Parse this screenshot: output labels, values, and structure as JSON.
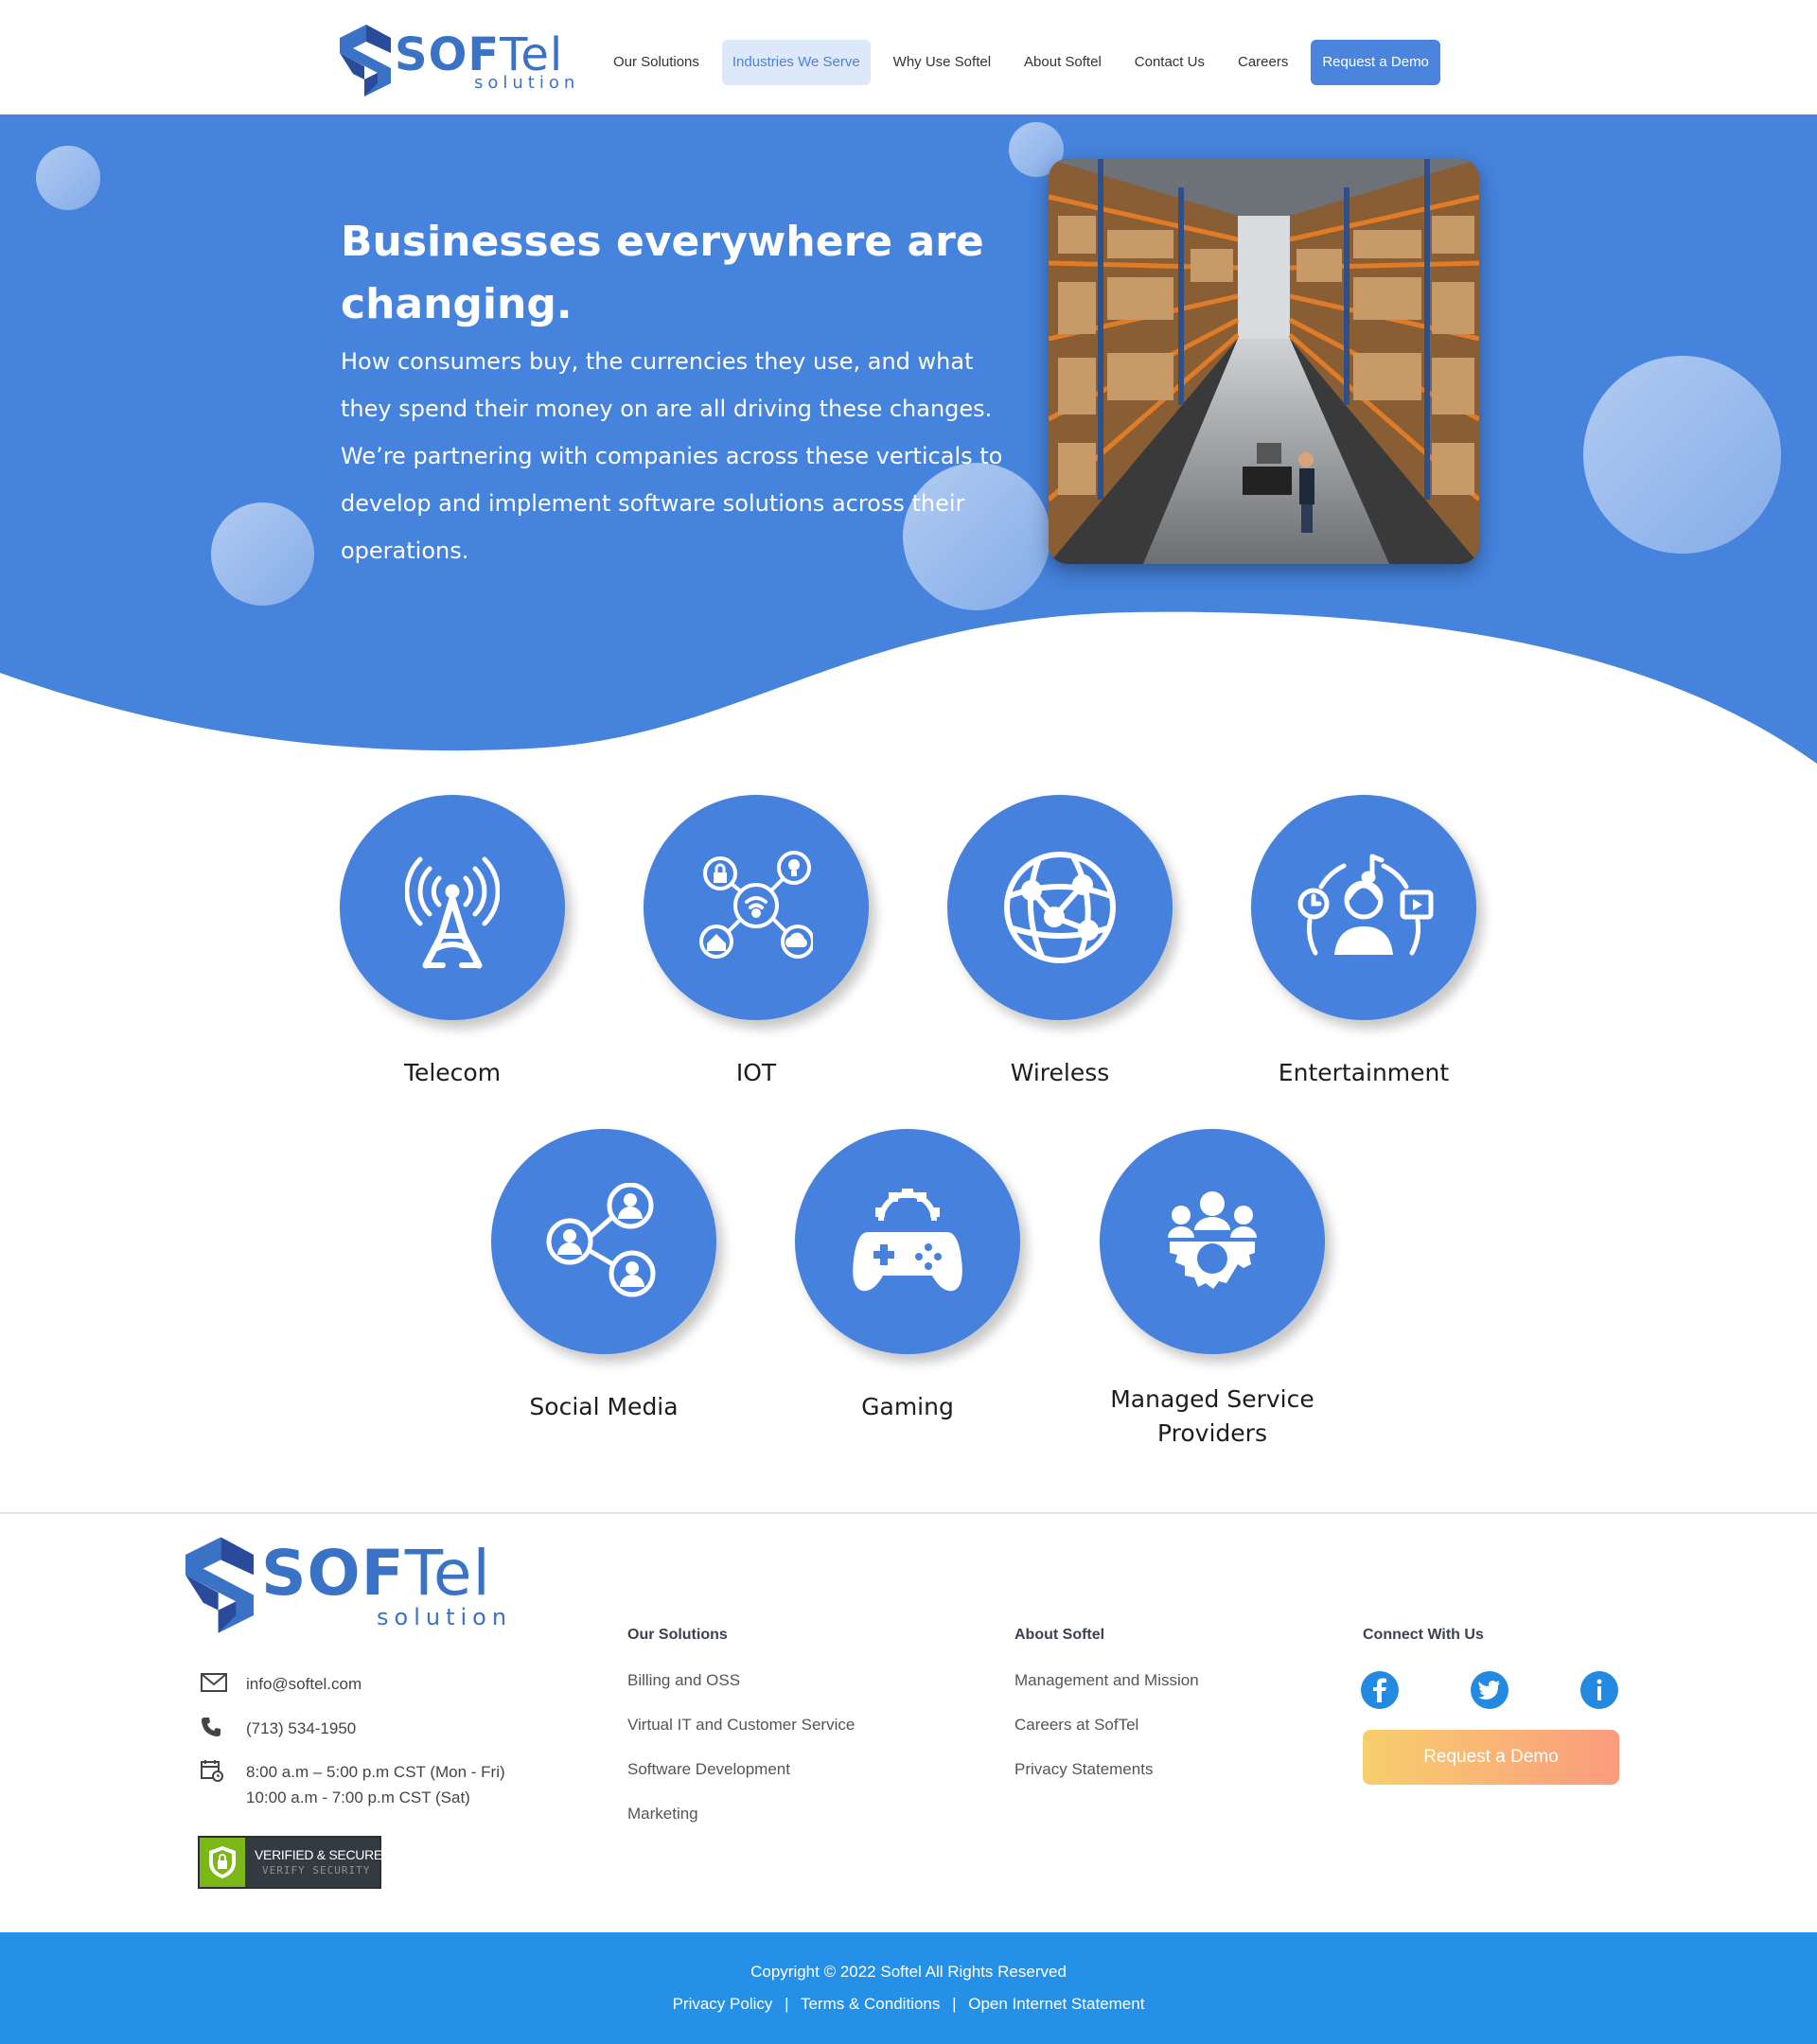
{
  "brand": {
    "name_bold": "SOF",
    "name_light": "Tel",
    "tagline": "solution",
    "colors": {
      "primary": "#4682dd",
      "accent_dark": "#2a4a9a",
      "footer_bar": "#2490e8",
      "cta_gradient_start": "#f7cf6d",
      "cta_gradient_end": "#fc9b7e"
    }
  },
  "nav": {
    "items": [
      {
        "label": "Our Solutions",
        "active": false
      },
      {
        "label": "Industries We Serve",
        "active": true
      },
      {
        "label": "Why Use Softel",
        "active": false
      },
      {
        "label": "About Softel",
        "active": false
      },
      {
        "label": "Contact Us",
        "active": false
      },
      {
        "label": "Careers",
        "active": false
      }
    ],
    "cta": "Request  a Demo"
  },
  "hero": {
    "title": "Businesses everywhere are changing.",
    "text": "How consumers buy, the currencies they use, and what they spend their money on are all driving these changes. We’re partnering with companies across these verticals to develop and implement software solutions across their operations.",
    "image": "warehouse-photo"
  },
  "industries": [
    {
      "label": "Telecom",
      "icon": "radio-tower-icon"
    },
    {
      "label": "IOT",
      "icon": "iot-network-icon"
    },
    {
      "label": "Wireless",
      "icon": "globe-network-icon"
    },
    {
      "label": "Entertainment",
      "icon": "media-user-icon"
    },
    {
      "label": "Social Media",
      "icon": "social-share-icon"
    },
    {
      "label": "Gaming",
      "icon": "gamepad-icon"
    },
    {
      "label": "Managed Service Providers",
      "icon": "team-gear-icon"
    }
  ],
  "footer": {
    "contact": {
      "email": "info@softel.com",
      "phone": "(713) 534-1950",
      "hours_weekday": "8:00 a.m – 5:00 p.m CST (Mon - Fri)",
      "hours_sat": "10:00 a.m - 7:00 p.m CST (Sat)"
    },
    "badge": {
      "line1": "VERIFIED & SECURED",
      "line2": "VERIFY SECURITY"
    },
    "solutions": {
      "heading": "Our Solutions",
      "links": [
        "Billing and OSS",
        "Virtual IT and Customer Service",
        "Software Development",
        "Marketing"
      ]
    },
    "about": {
      "heading": "About Softel",
      "links": [
        "Management and Mission",
        "Careers at SofTel",
        "Privacy Statements"
      ]
    },
    "connect": {
      "heading": "Connect With Us",
      "social": [
        "facebook-icon",
        "twitter-icon",
        "info-icon"
      ],
      "cta": "Request  a Demo"
    }
  },
  "bottom": {
    "copyright": "Copyright © 2022 Softel All Rights Reserved",
    "links": [
      "Privacy Policy",
      "Terms & Conditions",
      "Open Internet Statement"
    ],
    "separator": "|"
  }
}
